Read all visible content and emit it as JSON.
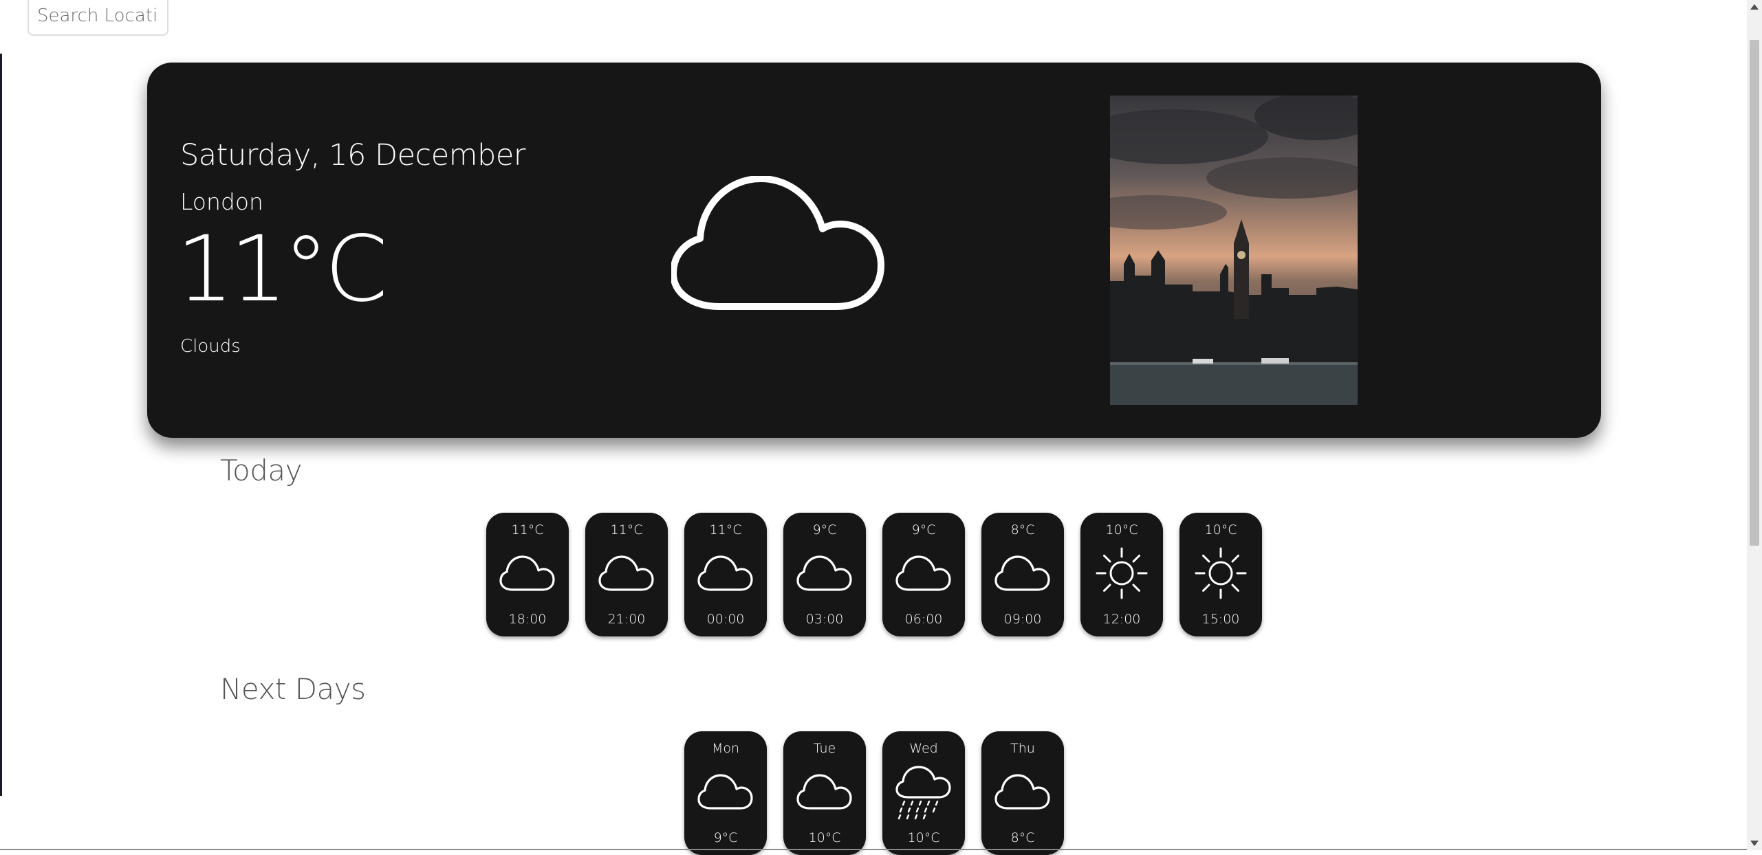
{
  "search": {
    "placeholder": "Search Location"
  },
  "current": {
    "date": "Saturday, 16 December",
    "city": "London",
    "temperature": "11°C",
    "condition": "Clouds",
    "icon": "cloud-icon"
  },
  "today": {
    "title": "Today",
    "hours": [
      {
        "temp": "11°C",
        "time": "18:00",
        "icon": "cloud-icon"
      },
      {
        "temp": "11°C",
        "time": "21:00",
        "icon": "cloud-icon"
      },
      {
        "temp": "11°C",
        "time": "00:00",
        "icon": "cloud-icon"
      },
      {
        "temp": "9°C",
        "time": "03:00",
        "icon": "cloud-icon"
      },
      {
        "temp": "9°C",
        "time": "06:00",
        "icon": "cloud-icon"
      },
      {
        "temp": "8°C",
        "time": "09:00",
        "icon": "cloud-icon"
      },
      {
        "temp": "10°C",
        "time": "12:00",
        "icon": "sun-icon"
      },
      {
        "temp": "10°C",
        "time": "15:00",
        "icon": "sun-icon"
      }
    ]
  },
  "next_days": {
    "title": "Next Days",
    "days": [
      {
        "day": "Mon",
        "temp": "9°C",
        "icon": "cloud-icon"
      },
      {
        "day": "Tue",
        "temp": "10°C",
        "icon": "cloud-icon"
      },
      {
        "day": "Wed",
        "temp": "10°C",
        "icon": "rain-cloud-icon"
      },
      {
        "day": "Thu",
        "temp": "8°C",
        "icon": "cloud-icon"
      }
    ]
  }
}
